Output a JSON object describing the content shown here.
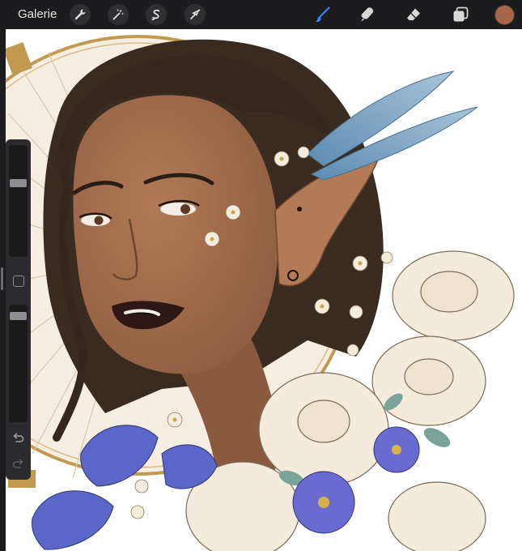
{
  "toolbar": {
    "gallery_label": "Galerie",
    "actions_icon": "wrench-icon",
    "adjustments_icon": "magic-wand-icon",
    "selection_icon": "selection-s-icon",
    "transform_icon": "arrow-cursor-icon",
    "brush_icon": "brush-icon",
    "smudge_icon": "smudge-icon",
    "eraser_icon": "eraser-icon",
    "layers_icon": "layers-icon",
    "active_color": "#a86749"
  },
  "sidebar": {
    "brush_size_level": 0.33,
    "opacity_level": 0.07,
    "undo_icon": "undo-icon",
    "redo_icon": "redo-icon",
    "modify_icon": "square-modify-icon"
  },
  "colors": {
    "toolbar_bg": "#1c1c1e",
    "brush_active": "#3b82f6",
    "skin": "#a06a4c",
    "hair": "#3a2b20",
    "halo_gold": "#c19a4f",
    "bluebell": "#5b66c9",
    "rose": "#f2e7d6",
    "wing": "#7fa9c8"
  }
}
